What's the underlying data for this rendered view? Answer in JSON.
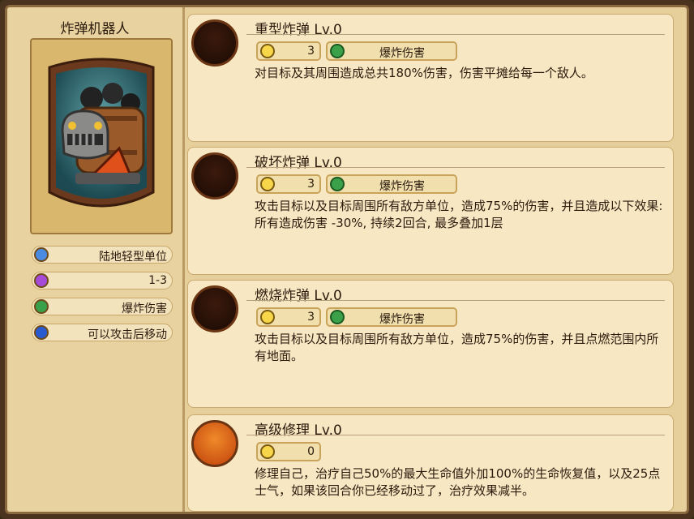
{
  "unit": {
    "name": "炸弹机器人",
    "tags": [
      {
        "icon": "person-icon",
        "label": "陆地轻型单位"
      },
      {
        "icon": "range-target-icon",
        "label": "1-3"
      },
      {
        "icon": "sword-icon",
        "label": "爆炸伤害"
      },
      {
        "icon": "move-attack-icon",
        "label": "可以攻击后移动"
      }
    ]
  },
  "skills": [
    {
      "title": "重型炸弹 Lv.0",
      "icon": "bomb-icon",
      "cooldown": "3",
      "damage_type": "爆炸伤害",
      "desc": "对目标及其周围造成总共180%伤害，伤害平摊给每一个敌人。"
    },
    {
      "title": "破坏炸弹 Lv.0",
      "icon": "broken-bomb-icon",
      "cooldown": "3",
      "damage_type": "爆炸伤害",
      "desc": "攻击目标以及目标周围所有敌方单位，造成75%的伤害，并且造成以下效果:\n所有造成伤害 -30%, 持续2回合, 最多叠加1层"
    },
    {
      "title": "燃烧炸弹 Lv.0",
      "icon": "fire-bomb-icon",
      "cooldown": "3",
      "damage_type": "爆炸伤害",
      "desc": "攻击目标以及目标周围所有敌方单位，造成75%的伤害，并且点燃范围内所有地面。"
    },
    {
      "title": "高级修理 Lv.0",
      "icon": "repair-tools-icon",
      "cooldown": "0",
      "damage_type": "",
      "desc": "修理自己，治疗自己50%的最大生命值外加100%的生命恢复值，以及25点士气，如果该回合你已经移动过了，治疗效果减半。"
    }
  ]
}
